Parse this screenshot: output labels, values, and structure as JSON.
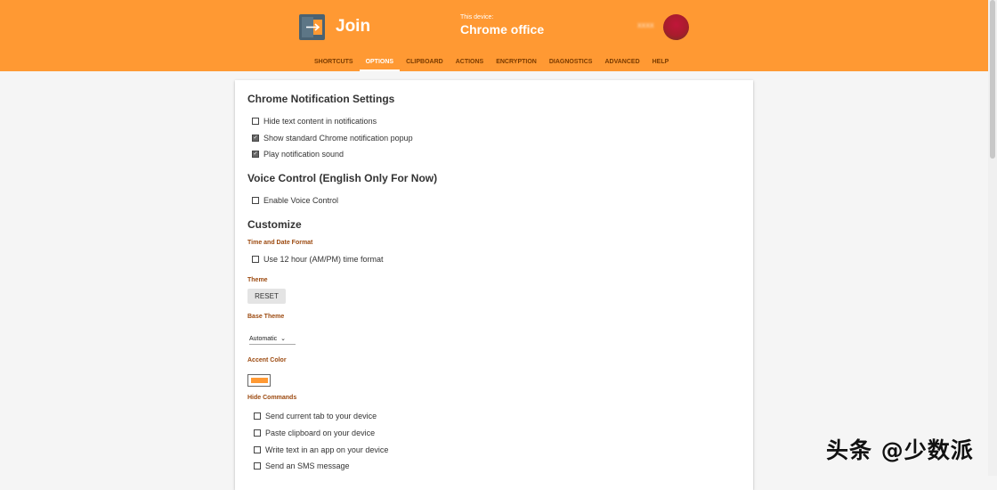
{
  "header": {
    "app_name": "Join",
    "device_caption": "This device:",
    "device_name": "Chrome office",
    "user_name": "XXXX",
    "logo_icon": "join-arrow-icon",
    "brand_color": "#ff9933"
  },
  "tabs": [
    {
      "label": "SHORTCUTS",
      "active": false
    },
    {
      "label": "OPTIONS",
      "active": true
    },
    {
      "label": "CLIPBOARD",
      "active": false
    },
    {
      "label": "ACTIONS",
      "active": false
    },
    {
      "label": "ENCRYPTION",
      "active": false
    },
    {
      "label": "DIAGNOSTICS",
      "active": false
    },
    {
      "label": "ADVANCED",
      "active": false
    },
    {
      "label": "HELP",
      "active": false
    }
  ],
  "notifications": {
    "title": "Chrome Notification Settings",
    "items": [
      {
        "label": "Hide text content in notifications",
        "checked": false
      },
      {
        "label": "Show standard Chrome notification popup",
        "checked": true
      },
      {
        "label": "Play notification sound",
        "checked": true
      }
    ]
  },
  "voice": {
    "title": "Voice Control (English Only For Now)",
    "items": [
      {
        "label": "Enable Voice Control",
        "checked": false
      }
    ]
  },
  "customize": {
    "title": "Customize",
    "time_label": "Time and Date Format",
    "time_option": {
      "label": "Use 12 hour (AM/PM) time format",
      "checked": false
    },
    "theme_label": "Theme",
    "reset_label": "RESET",
    "base_theme_label": "Base Theme",
    "base_theme_value": "Automatic",
    "accent_label": "Accent Color",
    "accent_color": "#ff9933",
    "hide_commands_label": "Hide Commands",
    "commands": [
      {
        "label": "Send current tab to your device",
        "checked": false
      },
      {
        "label": "Paste clipboard on your device",
        "checked": false
      },
      {
        "label": "Write text in an app on your device",
        "checked": false
      },
      {
        "label": "Send an SMS message",
        "checked": false
      }
    ]
  },
  "watermark": "头条 @少数派"
}
